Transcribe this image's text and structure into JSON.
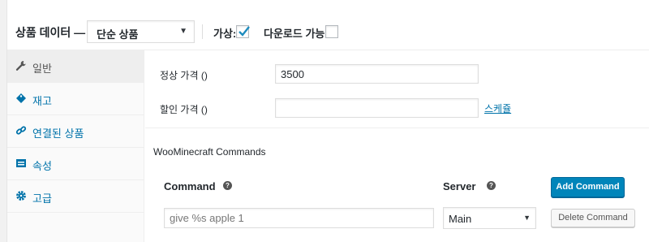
{
  "header": {
    "title": "상품 데이터 —",
    "product_type": "단순 상품",
    "virtual_label": "가상:",
    "virtual_checked": true,
    "downloadable_label": "다운로드 가능:",
    "downloadable_checked": false
  },
  "tabs": [
    {
      "label": "일반",
      "icon": "wrench-icon",
      "active": true
    },
    {
      "label": "재고",
      "icon": "tag-icon",
      "active": false
    },
    {
      "label": "연결된 상품",
      "icon": "link-icon",
      "active": false
    },
    {
      "label": "속성",
      "icon": "table-icon",
      "active": false
    },
    {
      "label": "고급",
      "icon": "gear-icon",
      "active": false
    }
  ],
  "general": {
    "regular_price_label": "정상 가격 ()",
    "regular_price_value": "3500",
    "sale_price_label": "할인 가격 ()",
    "sale_price_value": "",
    "schedule_link": "스케쥴"
  },
  "commands": {
    "section_title": "WooMinecraft Commands",
    "command_header": "Command",
    "server_header": "Server",
    "help_glyph": "?",
    "add_button": "Add Command",
    "rows": [
      {
        "command": "give %s apple 1",
        "server": "Main",
        "delete_button": "Delete Command"
      }
    ]
  },
  "colors": {
    "accent": "#0073aa",
    "primary_button": "#0085ba",
    "checkmark": "#1e8cbe"
  }
}
